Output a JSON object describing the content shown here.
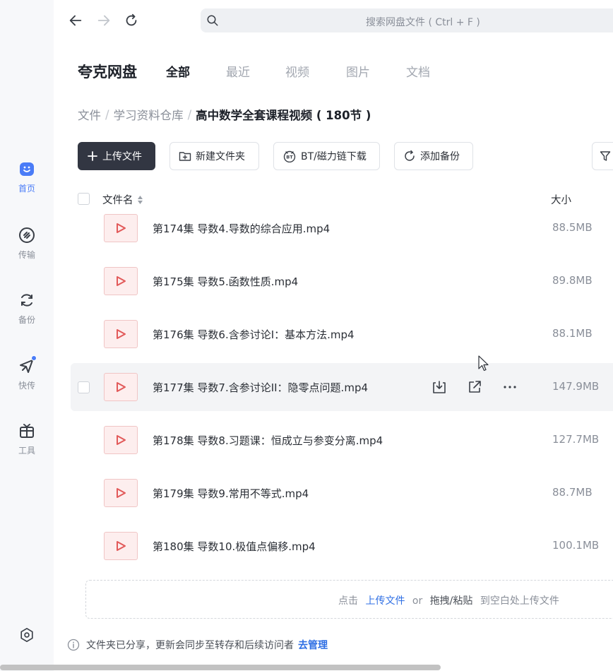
{
  "sidebar": {
    "items": [
      {
        "label": "首页",
        "icon": "home-icon",
        "active": true
      },
      {
        "label": "传输",
        "icon": "transfer-icon"
      },
      {
        "label": "备份",
        "icon": "backup-icon"
      },
      {
        "label": "快传",
        "icon": "quick-send-icon",
        "dot": true
      },
      {
        "label": "工具",
        "icon": "toolbox-icon"
      }
    ],
    "settings_icon": "settings-icon"
  },
  "nav": {
    "search_placeholder": "搜索网盘文件 ( Ctrl + F )"
  },
  "header": {
    "brand": "夸克网盘",
    "tabs": [
      {
        "label": "全部",
        "active": true
      },
      {
        "label": "最近"
      },
      {
        "label": "视频"
      },
      {
        "label": "图片"
      },
      {
        "label": "文档"
      }
    ]
  },
  "breadcrumb": {
    "items": [
      "文件",
      "学习资料仓库"
    ],
    "current": "高中数学全套课程视频 ( 180节 )"
  },
  "toolbar": {
    "upload": "上传文件",
    "new_folder": "新建文件夹",
    "bt_download": "BT/磁力链下载",
    "add_backup": "添加备份"
  },
  "list": {
    "col_name": "文件名",
    "col_size": "大小",
    "rows": [
      {
        "name": "第174集 导数4.导数的综合应用.mp4",
        "size": "88.5MB"
      },
      {
        "name": "第175集 导数5.函数性质.mp4",
        "size": "89.8MB"
      },
      {
        "name": "第176集 导数6.含参讨论I：基本方法.mp4",
        "size": "88.1MB"
      },
      {
        "name": "第177集 导数7.含参讨论II：隐零点问题.mp4",
        "size": "147.9MB",
        "hover": true
      },
      {
        "name": "第178集 导数8.习题课：恒成立与参变分离.mp4",
        "size": "127.7MB"
      },
      {
        "name": "第179集 导数9.常用不等式.mp4",
        "size": "88.7MB"
      },
      {
        "name": "第180集 导数10.极值点偏移.mp4",
        "size": "100.1MB"
      }
    ]
  },
  "dropzone": {
    "click": "点击",
    "upload": "上传文件",
    "or": "or",
    "drag": "拖拽/粘贴",
    "tail": "到空白处上传文件"
  },
  "notice": {
    "text": "文件夹已分享，更新会同步至转存和后续访问者",
    "link": "去管理"
  },
  "colors": {
    "accent": "#4a7cf7",
    "link": "#2f6fe4",
    "primary_button": "#323642",
    "video_icon": "#e25a5a"
  }
}
